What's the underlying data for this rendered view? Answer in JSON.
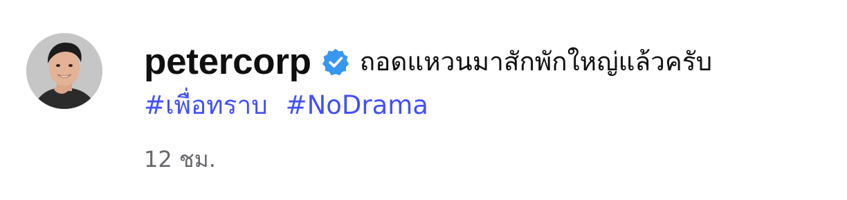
{
  "comment": {
    "avatar_icon": "profile-photo",
    "username": "petercorp",
    "verified_icon": "verified-badge-icon",
    "caption": "ถอดแหวนมาสักพักใหญ่แล้วครับ",
    "hashtags": [
      "#เพื่อทราบ",
      "#NoDrama"
    ],
    "timestamp": "12 ชม."
  },
  "colors": {
    "verified": "#3897f0",
    "hashtag": "#4150f7",
    "username": "#0f0f0f",
    "timestamp": "#65676b"
  }
}
